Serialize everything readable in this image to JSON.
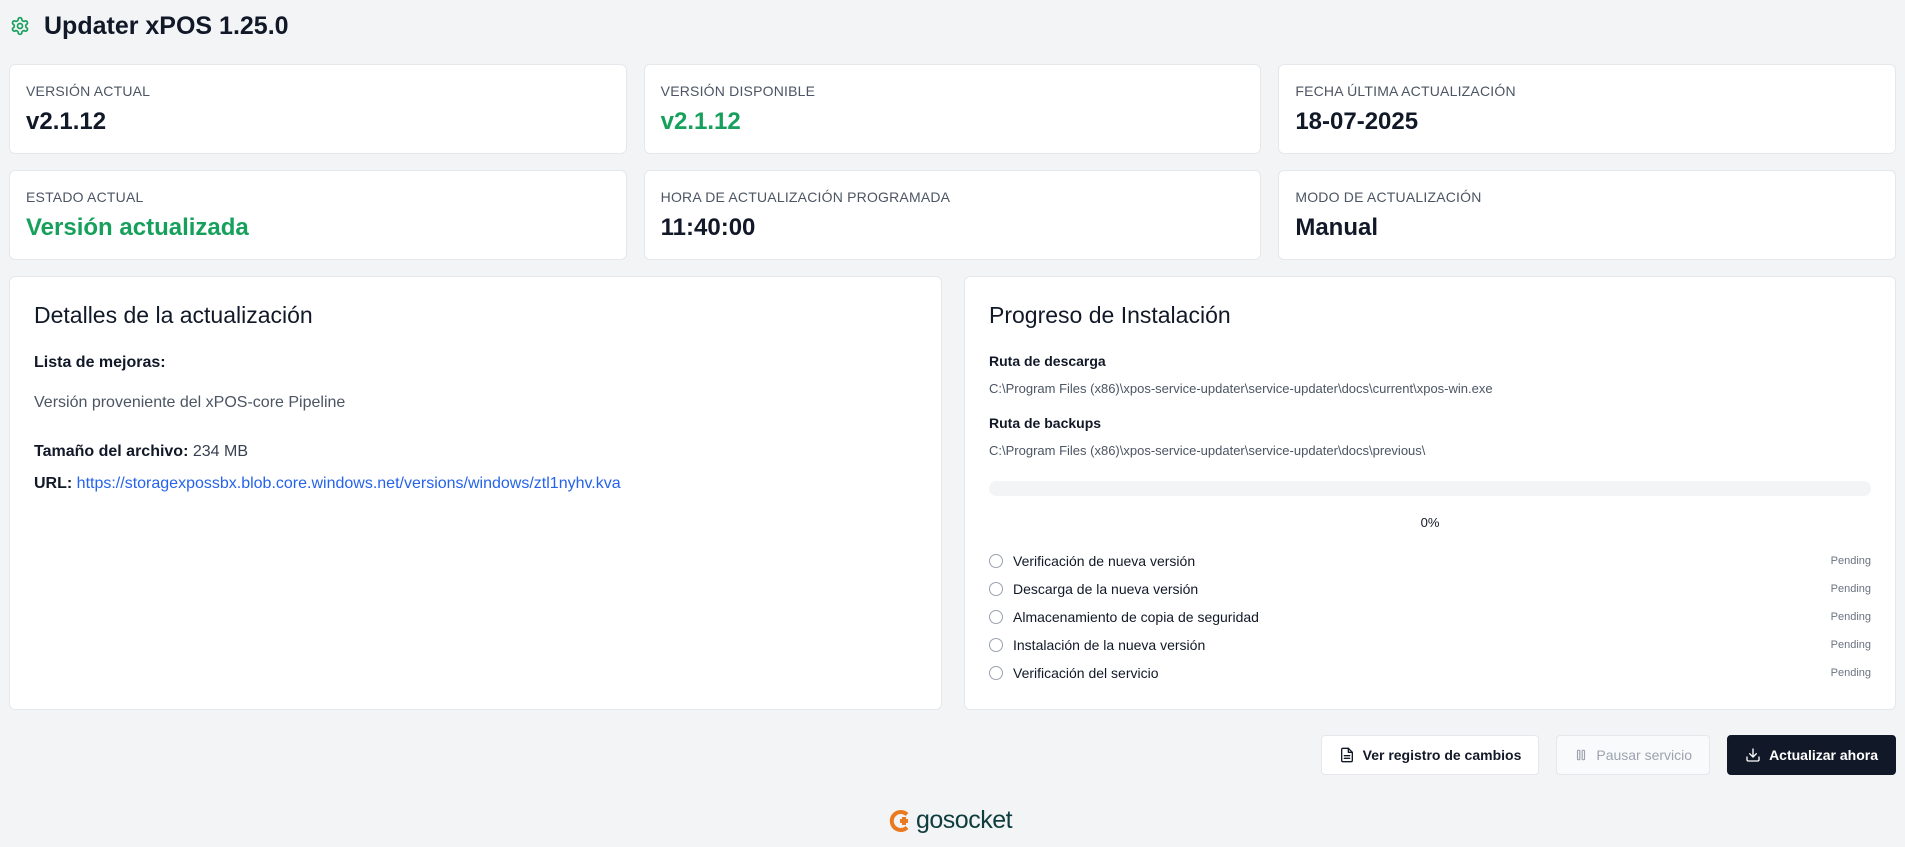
{
  "header": {
    "title": "Updater xPOS 1.25.0",
    "icon": "gear-icon",
    "icon_color": "#16a05b"
  },
  "stats": [
    {
      "label": "VERSIÓN ACTUAL",
      "value": "v2.1.12"
    },
    {
      "label": "VERSIÓN DISPONIBLE",
      "value": "v2.1.12"
    },
    {
      "label": "FECHA ÚLTIMA ACTUALIZACIÓN",
      "value": "18-07-2025"
    },
    {
      "label": "ESTADO ACTUAL",
      "value": "Versión actualizada"
    },
    {
      "label": "HORA DE ACTUALIZACIÓN PROGRAMADA",
      "value": "11:40:00"
    },
    {
      "label": "MODO DE ACTUALIZACIÓN",
      "value": "Manual"
    }
  ],
  "details": {
    "title": "Detalles de la actualización",
    "improvements_label": "Lista de mejoras:",
    "improvements_text": "Versión proveniente del xPOS-core Pipeline",
    "size_label": "Tamaño del archivo:",
    "size_value": "234 MB",
    "url_label": "URL:",
    "url_value": "https://storagexpossbx.blob.core.windows.net/versions/windows/ztl1nyhv.kva"
  },
  "progress": {
    "title": "Progreso de Instalación",
    "download_label": "Ruta de descarga",
    "download_path": "C:\\Program Files (x86)\\xpos-service-updater\\service-updater\\docs\\current\\xpos-win.exe",
    "backup_label": "Ruta de backups",
    "backup_path": "C:\\Program Files (x86)\\xpos-service-updater\\service-updater\\docs\\previous\\",
    "percent": 0,
    "percent_text": "0%",
    "steps": [
      {
        "name": "Verificación de nueva versión",
        "status": "Pending"
      },
      {
        "name": "Descarga de la nueva versión",
        "status": "Pending"
      },
      {
        "name": "Almacenamiento de copia de seguridad",
        "status": "Pending"
      },
      {
        "name": "Instalación de la nueva versión",
        "status": "Pending"
      },
      {
        "name": "Verificación del servicio",
        "status": "Pending"
      }
    ]
  },
  "actions": {
    "changelog_label": "Ver registro de cambios",
    "pause_label": "Pausar servicio",
    "update_label": "Actualizar ahora"
  },
  "footer": {
    "logo_text": "gosocket",
    "logo_color": "#ea7a1f"
  },
  "colors": {
    "accent_green": "#16a05b",
    "dark": "#111827",
    "link": "#2563eb"
  }
}
